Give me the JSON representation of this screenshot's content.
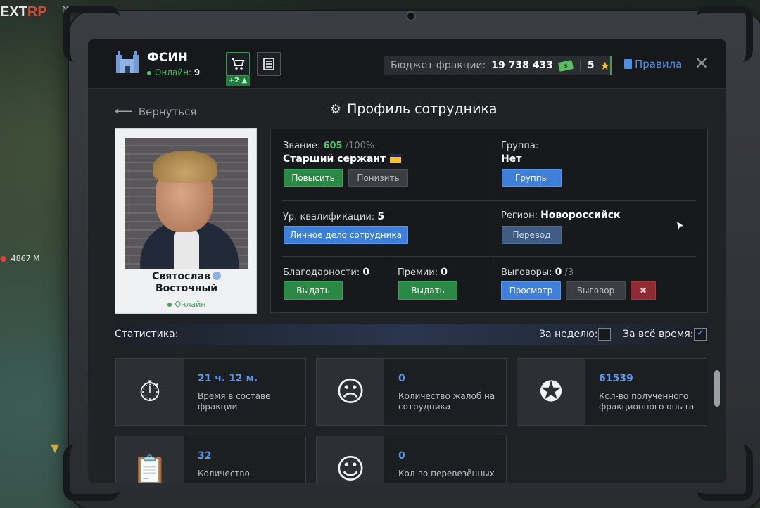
{
  "background": {
    "logo_text": "EXT",
    "logo_suffix": "RP",
    "tab_partial": "Мо",
    "distance": "4867 М"
  },
  "header": {
    "faction_name": "ФСИН",
    "online_label": "Онлайн:",
    "online_count": "9",
    "cart_badge": "+2",
    "budget_label": "Бюджет фракции:",
    "budget_value": "19 738 433",
    "stars_value": "5",
    "rules_label": "Правила"
  },
  "page": {
    "back_label": "Вернуться",
    "title": "Профиль сотрудника"
  },
  "profile": {
    "first_name": "Святослав",
    "last_name": "Восточный",
    "status": "Онлайн"
  },
  "info": {
    "rank_label": "Звание:",
    "rank_points": "605",
    "rank_max": "/100%",
    "rank_name": "Старший сержант",
    "promote_btn": "Повысить",
    "demote_btn": "Понизить",
    "group_label": "Группа:",
    "group_value": "Нет",
    "groups_btn": "Группы",
    "qual_label": "Ур. квалификации:",
    "qual_value": "5",
    "file_btn": "Личное дело сотрудника",
    "region_label": "Регион:",
    "region_value": "Новороссийск",
    "transfer_btn": "Перевод",
    "thanks_label": "Благодарности:",
    "thanks_value": "0",
    "thanks_btn": "Выдать",
    "bonus_label": "Премии:",
    "bonus_value": "0",
    "bonus_btn": "Выдать",
    "reprimand_label": "Выговоры:",
    "reprimand_value": "0",
    "reprimand_max": "/3",
    "view_btn": "Просмотр",
    "reprimand_btn": "Выговор"
  },
  "stats": {
    "title": "Статистика:",
    "week_label": "За неделю:",
    "week_checked": false,
    "all_label": "За всё время:",
    "all_checked": true,
    "cards": [
      {
        "icon": "stopwatch-icon",
        "value": "21 ч. 12 м.",
        "desc": "Время в составе фракции"
      },
      {
        "icon": "complaint-icon",
        "value": "0",
        "desc": "Количество жалоб на сотрудника"
      },
      {
        "icon": "exp-stars-icon",
        "value": "61539",
        "desc": "Кол-во полученного фракционного опыта"
      },
      {
        "icon": "clipboard-icon",
        "value": "32",
        "desc": "Количество"
      },
      {
        "icon": "prisoner-icon",
        "value": "0",
        "desc": "Кол-во перевезённых"
      }
    ]
  },
  "colors": {
    "accent_blue": "#3d7fd9",
    "accent_green": "#2a8a45",
    "online_green": "#47c46a"
  }
}
